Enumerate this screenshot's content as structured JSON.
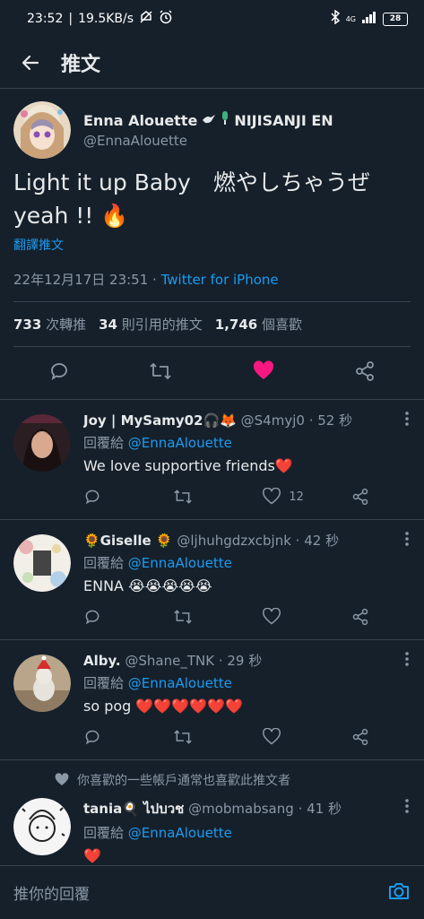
{
  "status_bar": {
    "time": "23:52",
    "speed": "19.5KB/s",
    "signal": "4G",
    "battery": "28"
  },
  "header": {
    "title": "推文"
  },
  "tweet": {
    "author_name": "Enna Alouette",
    "author_badge": "NIJISANJI EN",
    "handle": "@EnnaAlouette",
    "text": "Light it up Baby　燃やしちゃうぜ yeah !! 🔥",
    "translate": "翻譯推文",
    "date": "22年12月17日 23:51",
    "separator": " · ",
    "source": "Twitter for iPhone",
    "stats": [
      {
        "value": "733",
        "label": "次轉推"
      },
      {
        "value": "34",
        "label": "則引用的推文"
      },
      {
        "value": "1,746",
        "label": "個喜歡"
      }
    ]
  },
  "replies": [
    {
      "name": "Joy | MySamy02🎧🦊",
      "handle": "@S4myj0",
      "time": "· 52 秒",
      "replying_to_label": "回覆給",
      "replying_to": "@EnnaAlouette",
      "text": "We love supportive friends❤️",
      "like_count": "12"
    },
    {
      "name": "🌻Giselle 🌻",
      "handle": "@ljhuhgdzxcbjnk",
      "time": "· 42 秒",
      "replying_to_label": "回覆給",
      "replying_to": "@EnnaAlouette",
      "text": "ENNA 😭😭😭😭😭",
      "like_count": ""
    },
    {
      "name": "Alby.",
      "handle": "@Shane_TNK",
      "time": "· 29 秒",
      "replying_to_label": "回覆給",
      "replying_to": "@EnnaAlouette",
      "text": "so pog ❤️❤️❤️❤️❤️❤️",
      "like_count": ""
    },
    {
      "name": "tania🍳 ไปบวช",
      "handle": "@mobmabsang",
      "time": "· 41 秒",
      "replying_to_label": "回覆給",
      "replying_to": "@EnnaAlouette",
      "text": "❤️",
      "like_count": ""
    }
  ],
  "social_context": "你喜歡的一些帳戶通常也喜歡此推文者",
  "compose": {
    "placeholder": "推你的回覆"
  },
  "colors": {
    "background": "#15202b",
    "accent": "#1d9bf0",
    "like": "#f91880",
    "divider": "#38444d"
  }
}
